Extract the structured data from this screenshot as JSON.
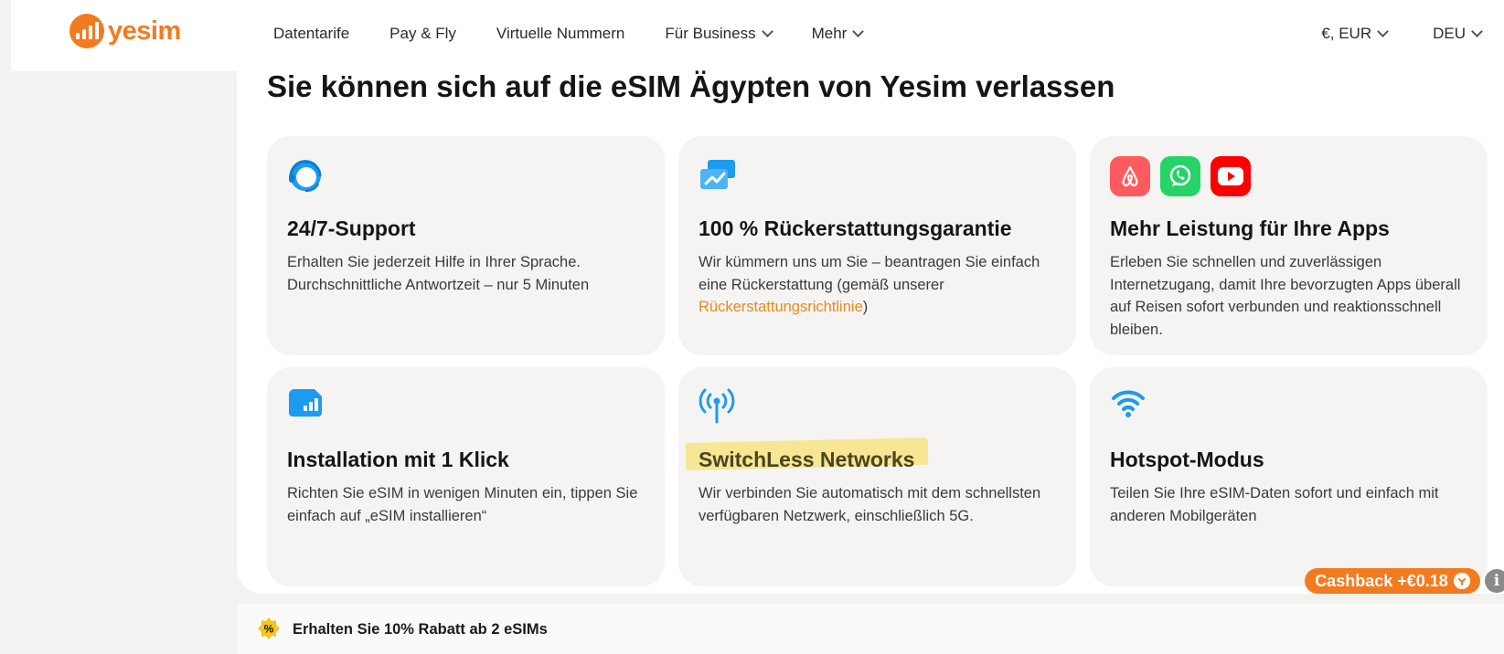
{
  "brand": {
    "name": "yesim",
    "accent": "#f37b1f"
  },
  "nav": {
    "items": [
      {
        "label": "Datentarife",
        "dropdown": false
      },
      {
        "label": "Pay & Fly",
        "dropdown": false
      },
      {
        "label": "Virtuelle Nummern",
        "dropdown": false
      },
      {
        "label": "Für Business",
        "dropdown": true
      },
      {
        "label": "Mehr",
        "dropdown": true
      }
    ],
    "currency": "€, EUR",
    "language": "DEU"
  },
  "section": {
    "title": "Sie können sich auf die eSIM Ägypten von Yesim verlassen"
  },
  "cards": [
    {
      "icon": "headset-icon",
      "title": "24/7-Support",
      "text": "Erhalten Sie jederzeit Hilfe in Ihrer Sprache. Durchschnittliche Antwortzeit – nur 5 Minuten"
    },
    {
      "icon": "refund-cards-icon",
      "title": "100 % Rückerstattungsgarantie",
      "text_before": "Wir kümmern uns um Sie – beantragen Sie einfach eine Rückerstattung (gemäß unserer ",
      "link": "Rückerstattungsrichtlinie",
      "text_after": ")"
    },
    {
      "icons": [
        "airbnb-icon",
        "whatsapp-icon",
        "youtube-icon"
      ],
      "title": "Mehr Leistung für Ihre Apps",
      "text": "Erleben Sie schnellen und zuverlässigen Internetzugang, damit Ihre bevorzugten Apps überall auf Reisen sofort verbunden und reaktionsschnell bleiben."
    },
    {
      "icon": "sim-signal-icon",
      "title": "Installation mit 1 Klick",
      "text": "Richten Sie eSIM in wenigen Minuten ein, tippen Sie einfach auf „eSIM installieren“"
    },
    {
      "icon": "antenna-icon",
      "title": "SwitchLess Networks",
      "text": "Wir verbinden Sie automatisch mit dem schnellsten verfügbaren Netzwerk, einschließlich 5G."
    },
    {
      "icon": "wifi-icon",
      "title": "Hotspot-Modus",
      "text": "Teilen Sie Ihre eSIM-Daten sofort und einfach mit anderen Mobilgeräten"
    }
  ],
  "cashback": {
    "label": "Cashback +€0.18"
  },
  "info": {
    "label": "i"
  },
  "promo": {
    "icon_label": "%",
    "text": "Erhalten Sie 10% Rabatt ab 2 eSIMs"
  }
}
